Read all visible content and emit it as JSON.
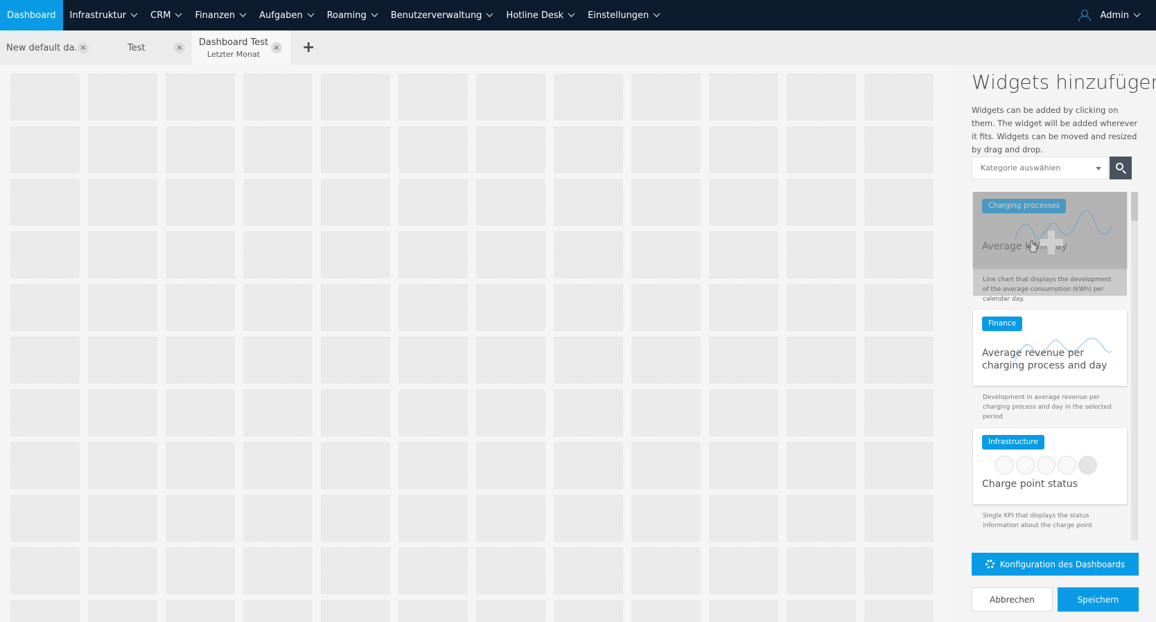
{
  "nav": {
    "items": [
      {
        "label": "Dashboard",
        "active": true,
        "dropdown": false
      },
      {
        "label": "Infrastruktur",
        "dropdown": true
      },
      {
        "label": "CRM",
        "dropdown": true
      },
      {
        "label": "Finanzen",
        "dropdown": true
      },
      {
        "label": "Aufgaben",
        "dropdown": true
      },
      {
        "label": "Roaming",
        "dropdown": true
      },
      {
        "label": "Benutzerverwaltung",
        "dropdown": true
      },
      {
        "label": "Hotline Desk",
        "dropdown": true
      },
      {
        "label": "Einstellungen",
        "dropdown": true
      }
    ],
    "user": {
      "label": "Admin",
      "icon": "user-icon"
    }
  },
  "tabs": [
    {
      "label": "New default da...",
      "close": "×"
    },
    {
      "label": "Test",
      "close": "×"
    },
    {
      "label": "Dashboard Test",
      "sublabel": "Letzter Monat",
      "close": "×",
      "active": true
    }
  ],
  "add_tab_label": "+",
  "panel": {
    "title": "Widgets hinzufügen",
    "description": "Widgets can be added by clicking on them. The widget will be added wherever it fits. Widgets can be moved and resized by drag and drop.",
    "category_placeholder": "Kategorie auswählen",
    "widgets": [
      {
        "category": "Charging processes",
        "title": "Average kWh day",
        "description": "Line chart that displays the development of the average consumption (kWh) per calendar day."
      },
      {
        "category": "Finance",
        "title": "Average revenue per charging process and day",
        "description": "Development in average revenue per charging process and day in the selected period"
      },
      {
        "category": "Infrastructure",
        "title": "Charge point status",
        "description": "Single KPI that displays the status information about the charge point"
      }
    ],
    "config_label": "Konfiguration des Dashboards",
    "cancel_label": "Abbrechen",
    "save_label": "Speichern"
  },
  "colors": {
    "nav_bg": "#0d1b2e",
    "accent": "#0a9be6",
    "search_btn": "#4a5360"
  }
}
